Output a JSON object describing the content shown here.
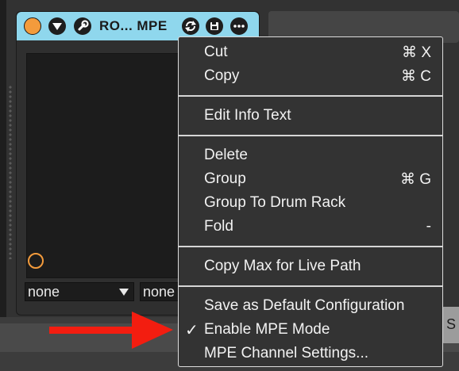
{
  "device": {
    "title": "RO... MPE",
    "select_1_value": "none",
    "select_2_value": "none"
  },
  "background": {
    "s_button_label": "S"
  },
  "context_menu": {
    "groups": [
      [
        {
          "label": "Cut",
          "shortcut": "⌘ X"
        },
        {
          "label": "Copy",
          "shortcut": "⌘ C"
        }
      ],
      [
        {
          "label": "Edit Info Text",
          "shortcut": ""
        }
      ],
      [
        {
          "label": "Delete",
          "shortcut": ""
        },
        {
          "label": "Group",
          "shortcut": "⌘ G"
        },
        {
          "label": "Group To Drum Rack",
          "shortcut": ""
        },
        {
          "label": "Fold",
          "shortcut": "-"
        }
      ],
      [
        {
          "label": "Copy Max for Live Path",
          "shortcut": ""
        }
      ],
      [
        {
          "label": "Save as Default Configuration",
          "shortcut": ""
        },
        {
          "label": "Enable MPE Mode",
          "shortcut": "",
          "checked": true,
          "check_glyph": "✓"
        },
        {
          "label": "MPE Channel Settings...",
          "shortcut": ""
        }
      ]
    ]
  },
  "colors": {
    "header_bg": "#8fd7ed",
    "power_orange": "#f39b3c",
    "annotation_arrow": "#f31d10"
  },
  "icons": {
    "power": "power-icon",
    "dropdown": "triangle-down-icon",
    "wrench": "wrench-icon",
    "hotswap": "hotswap-icon",
    "save": "save-icon",
    "more": "more-icon"
  }
}
